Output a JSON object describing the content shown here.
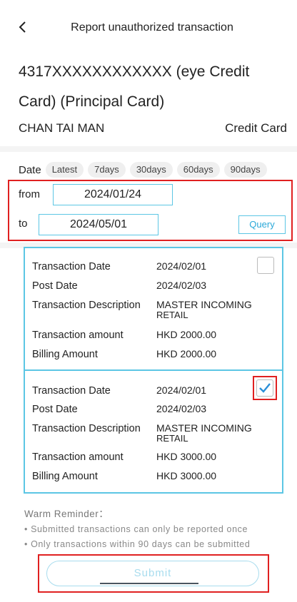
{
  "header": {
    "title": "Report unauthorized transaction",
    "back_icon": "chevron-left-icon"
  },
  "card": {
    "title": "4317XXXXXXXXXXXX (eye Credit Card) (Principal Card)",
    "holder": "CHAN TAI MAN",
    "type": "Credit Card"
  },
  "date_filter": {
    "label": "Date",
    "chips": [
      "Latest",
      "7days",
      "30days",
      "60days",
      "90days"
    ]
  },
  "range": {
    "from_label": "from",
    "from_value": "2024/01/24",
    "to_label": "to",
    "to_value": "2024/05/01",
    "query_label": "Query"
  },
  "transactions": [
    {
      "date_label": "Transaction Date",
      "date": "2024/02/01",
      "post_label": "Post Date",
      "post": "2024/02/03",
      "desc_label": "Transaction Description",
      "desc_line1": "MASTER INCOMING",
      "desc_line2": "RETAIL",
      "amount_label": "Transaction amount",
      "amount": "HKD 2000.00",
      "billing_label": "Billing Amount",
      "billing": "HKD 2000.00",
      "checked": false
    },
    {
      "date_label": "Transaction Date",
      "date": "2024/02/01",
      "post_label": "Post Date",
      "post": "2024/02/03",
      "desc_label": "Transaction Description",
      "desc_line1": "MASTER INCOMING",
      "desc_line2": "RETAIL",
      "amount_label": "Transaction amount",
      "amount": "HKD 3000.00",
      "billing_label": "Billing Amount",
      "billing": "HKD 3000.00",
      "checked": true
    }
  ],
  "reminder": {
    "title": "Warm Reminder：",
    "items": [
      "Submitted transactions can only be reported once",
      "Only transactions within 90 days can be submitted"
    ]
  },
  "submit_label": "Submit",
  "colors": {
    "accent": "#5cc6e4",
    "highlight": "#e02020",
    "check": "#2a8fd8"
  }
}
